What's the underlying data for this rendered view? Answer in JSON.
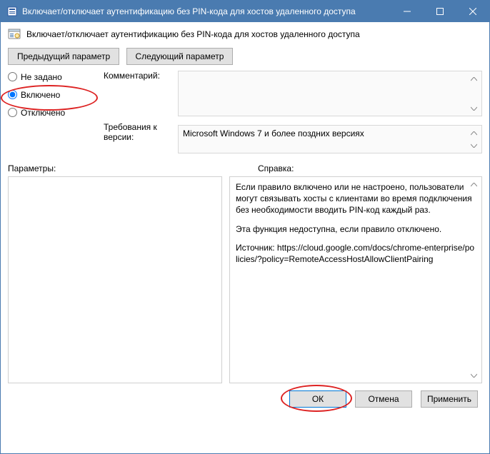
{
  "window": {
    "title": "Включает/отключает аутентификацию без PIN-кода для хостов удаленного доступа"
  },
  "header": {
    "policy_title": "Включает/отключает аутентификацию без PIN-кода для хостов удаленного доступа"
  },
  "nav": {
    "prev": "Предыдущий параметр",
    "next": "Следующий параметр"
  },
  "radios": {
    "not_configured": "Не задано",
    "enabled": "Включено",
    "disabled": "Отключено",
    "selected": "enabled"
  },
  "labels": {
    "comment": "Комментарий:",
    "supported": "Требования к версии:",
    "options": "Параметры:",
    "help": "Справка:"
  },
  "fields": {
    "comment": "",
    "supported": "Microsoft Windows 7 и более поздних версиях"
  },
  "help": {
    "p1": "Если правило включено или не настроено, пользователи могут связывать хосты с клиентами во время подключения без необходимости вводить PIN-код каждый раз.",
    "p2": "Эта функция недоступна, если правило отключено.",
    "p3": "Источник: https://cloud.google.com/docs/chrome-enterprise/policies/?policy=RemoteAccessHostAllowClientPairing"
  },
  "footer": {
    "ok": "ОК",
    "cancel": "Отмена",
    "apply": "Применить"
  },
  "annotations": {
    "highlight_enabled_radio": true,
    "highlight_ok_button": true
  }
}
